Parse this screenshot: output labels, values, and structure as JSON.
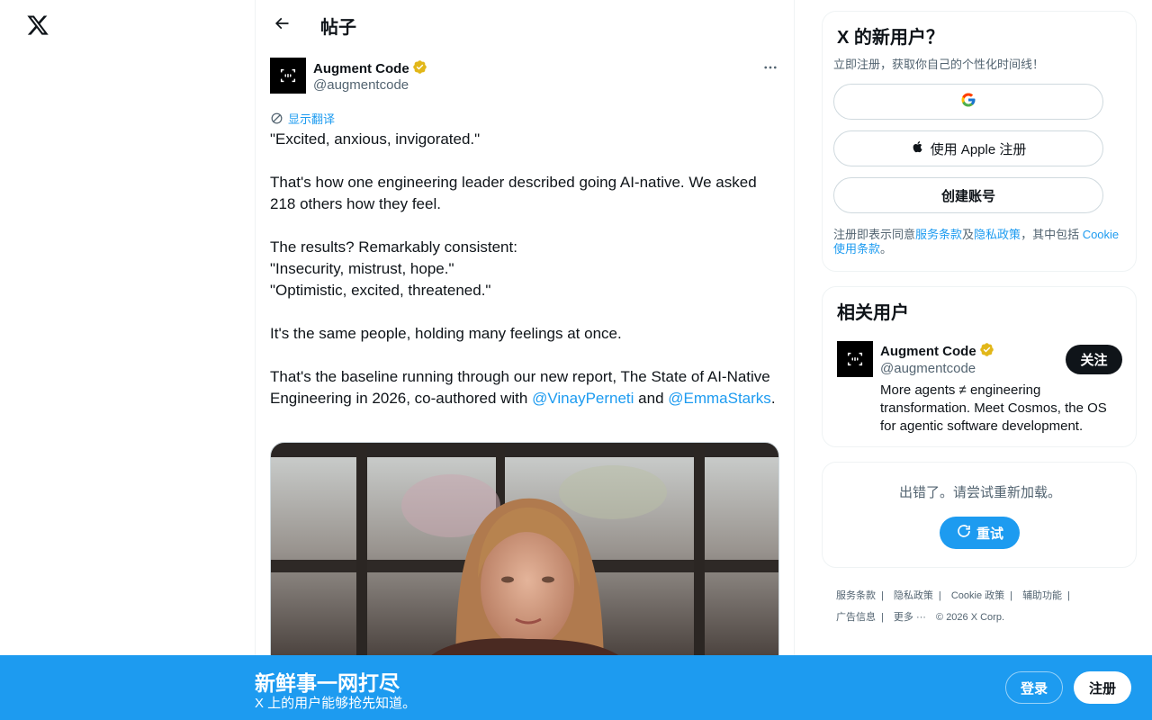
{
  "header": {
    "title": "帖子"
  },
  "post": {
    "author_name": "Augment Code",
    "author_handle": "@augmentcode",
    "translate_label": "显示翻译",
    "paragraphs": {
      "p1": "\"Excited, anxious, invigorated.\"",
      "p2": "That's how one engineering leader described going AI-native. We asked 218 others how they feel.",
      "p3a": "The results? Remarkably consistent:",
      "p3b": "\"Insecurity, mistrust, hope.\"",
      "p3c": "\"Optimistic, excited, threatened.\"",
      "p4": "It's the same people, holding many feelings at once.",
      "p5_prefix": "That's the baseline running through our new report, The State of AI-Native Engineering in 2026, co-authored with ",
      "mention1": "@VinayPerneti",
      "and": " and ",
      "mention2": "@EmmaStarks",
      "period": "."
    }
  },
  "signup_card": {
    "title": "X 的新用户？",
    "subtitle": "立即注册，获取你自己的个性化时间线！",
    "apple_label": "使用 Apple 注册",
    "create_label": "创建账号",
    "terms_prefix": "注册即表示同意",
    "terms_link": "服务条款",
    "and_text": "及",
    "privacy_link": "隐私政策",
    "includes_text": "，其中包括 ",
    "cookie_link": "Cookie 使用条款",
    "end": "。"
  },
  "related": {
    "title": "相关用户",
    "name": "Augment Code",
    "handle": "@augmentcode",
    "bio": "More agents ≠ engineering transformation. Meet Cosmos, the OS for agentic software development.",
    "follow_label": "关注"
  },
  "error_card": {
    "message": "出错了。请尝试重新加载。",
    "retry_label": "重试"
  },
  "footer": {
    "links": [
      "服务条款",
      "隐私政策",
      "Cookie 政策",
      "辅助功能",
      "广告信息",
      "更多 ···"
    ],
    "copyright": "© 2026 X Corp."
  },
  "banner": {
    "title": "新鲜事一网打尽",
    "subtitle": "X 上的用户能够抢先知道。",
    "login_label": "登录",
    "signup_label": "注册"
  },
  "colors": {
    "accent": "#1d9bf0",
    "text": "#0f1419",
    "muted": "#536471",
    "verified": "#e2b719"
  }
}
